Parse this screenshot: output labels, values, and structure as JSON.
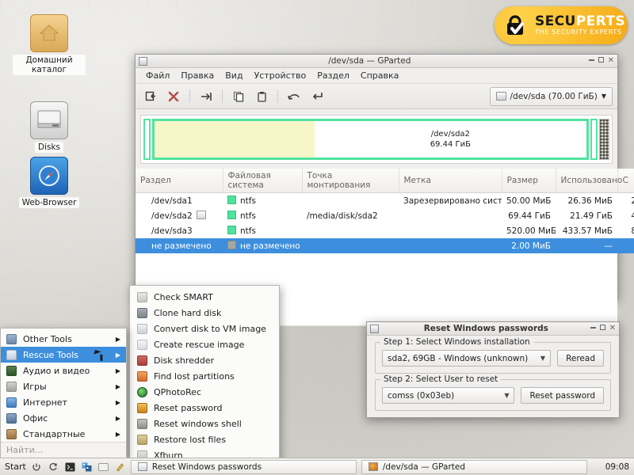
{
  "desktop": {
    "icons": [
      {
        "name": "home-folder",
        "label": "Домашний каталог",
        "icon": "home-icon"
      },
      {
        "name": "disks",
        "label": "Disks",
        "icon": "drive-icon"
      },
      {
        "name": "web-browser",
        "label": "Web-Browser",
        "icon": "compass-icon"
      }
    ]
  },
  "logo": {
    "icon": "lock-check-icon",
    "brand_primary": "SECU",
    "brand_secondary": "PERTS",
    "tagline": "THE SECURITY EXPERTS",
    "bg_color": "#f5ab16"
  },
  "gparted": {
    "title": "/dev/sda — GParted",
    "window_icon": "gparted-icon",
    "buttons": {
      "minimize": "minimize-icon",
      "maximize": "maximize-icon",
      "close": "close-icon"
    },
    "menu": [
      "Файл",
      "Правка",
      "Вид",
      "Устройство",
      "Раздел",
      "Справка"
    ],
    "toolbar": [
      {
        "name": "new-partition-button",
        "glyph": "⊐"
      },
      {
        "name": "delete-partition-button",
        "glyph": "✖"
      },
      {
        "name": "resize-move-button",
        "glyph": "⇥"
      },
      {
        "name": "copy-button",
        "glyph": "❐"
      },
      {
        "name": "paste-button",
        "glyph": "📋"
      },
      {
        "name": "undo-button",
        "glyph": "↶"
      },
      {
        "name": "apply-button",
        "glyph": "↵"
      }
    ],
    "device_selector": {
      "label": "/dev/sda  (70.00 ГиБ)",
      "arrow": "▼",
      "icon": "hdd-icon"
    },
    "graphic": {
      "main_partition": "/dev/sda2",
      "main_size": "69.44 ГиБ",
      "used_fraction_pct": 37
    },
    "table": {
      "columns": [
        "Раздел",
        "Файловая система",
        "Точка монтирования",
        "Метка",
        "Размер",
        "Использовано",
        "С"
      ],
      "rows": [
        {
          "partition": "/dev/sda1",
          "fs": "ntfs",
          "fs_color": "#4ee39e",
          "mount": "",
          "label": "Зарезервировано системой",
          "size": "50.00 МиБ",
          "used": "26.36 МиБ",
          "free": "2",
          "mounted_icon": false,
          "selected": false
        },
        {
          "partition": "/dev/sda2",
          "fs": "ntfs",
          "fs_color": "#4ee39e",
          "mount": "/media/disk/sda2",
          "label": "",
          "size": "69.44 ГиБ",
          "used": "21.49 ГиБ",
          "free": "4",
          "mounted_icon": true,
          "selected": false
        },
        {
          "partition": "/dev/sda3",
          "fs": "ntfs",
          "fs_color": "#4ee39e",
          "mount": "",
          "label": "",
          "size": "520.00 МиБ",
          "used": "433.57 МиБ",
          "free": "8",
          "mounted_icon": false,
          "selected": false
        },
        {
          "partition": "не размечено",
          "fs": "не размечено",
          "fs_color": "#a8a6a2",
          "mount": "",
          "label": "",
          "size": "2.00 МиБ",
          "used": "—",
          "free": "",
          "mounted_icon": false,
          "selected": true
        }
      ]
    }
  },
  "reset_dialog": {
    "title": "Reset Windows passwords",
    "window_icon": "app-icon",
    "buttons": {
      "minimize": "minimize-icon",
      "maximize": "maximize-icon",
      "close": "close-icon"
    },
    "step1": {
      "legend": "Step 1: Select Windows installation",
      "combo_value": "sda2, 69GB - Windows (unknown)",
      "combo_arrow": "▼",
      "button": "Reread"
    },
    "step2": {
      "legend": "Step 2: Select User to reset",
      "combo_value": "comss (0x03eb)",
      "combo_arrow": "▼",
      "button": "Reset password"
    }
  },
  "submenu": {
    "items": [
      {
        "label": "Check SMART",
        "icon": "smart-icon",
        "color": "#cfcfcb"
      },
      {
        "label": "Clone hard disk",
        "icon": "clone-icon",
        "color": "#8e9095"
      },
      {
        "label": "Convert disk to VM image",
        "icon": "convert-icon",
        "color": "#d5d8dc"
      },
      {
        "label": "Create rescue image",
        "icon": "rescue-image-icon",
        "color": "#dfe2e6"
      },
      {
        "label": "Disk shredder",
        "icon": "shredder-icon",
        "color": "#c0504d"
      },
      {
        "label": "Find lost partitions",
        "icon": "find-partitions-icon",
        "color": "#e08a3c"
      },
      {
        "label": "QPhotoRec",
        "icon": "qphotorec-icon",
        "color": "#2f8f3f"
      },
      {
        "label": "Reset password",
        "icon": "reset-password-icon",
        "color": "#e2a43a"
      },
      {
        "label": "Reset windows shell",
        "icon": "reset-shell-icon",
        "color": "#9b9b97"
      },
      {
        "label": "Restore lost files",
        "icon": "restore-files-icon",
        "color": "#c3b47a"
      },
      {
        "label": "Xfburn",
        "icon": "xfburn-icon",
        "color": "#c8c8c4"
      }
    ]
  },
  "startmenu": {
    "items": [
      {
        "label": "Other Tools",
        "icon": "other-tools-icon",
        "color": "#8aa6c8",
        "chevron": "▶",
        "active": false
      },
      {
        "label": "Rescue Tools",
        "icon": "rescue-tools-icon",
        "color": "#cdd6e2",
        "chevron": "▶",
        "active": true
      },
      {
        "label": "Аудио и видео",
        "icon": "audio-video-icon",
        "color": "#3f6b35",
        "chevron": "▶",
        "active": false
      },
      {
        "label": "Игры",
        "icon": "games-icon",
        "color": "#b8b8b4",
        "chevron": "▶",
        "active": false
      },
      {
        "label": "Интернет",
        "icon": "internet-icon",
        "color": "#5b9bd5",
        "chevron": "▶",
        "active": false
      },
      {
        "label": "Офис",
        "icon": "office-icon",
        "color": "#6e8fb5",
        "chevron": "▶",
        "active": false
      },
      {
        "label": "Стандартные",
        "icon": "accessories-icon",
        "color": "#b08a57",
        "chevron": "▶",
        "active": false
      }
    ],
    "search_placeholder": "Найти..."
  },
  "taskbar": {
    "start_label": "Start",
    "sysicons": [
      {
        "name": "power-icon",
        "glyph": "⏻"
      },
      {
        "name": "restart-icon",
        "glyph": "⟳"
      },
      {
        "name": "terminal-icon",
        "glyph": "▰"
      },
      {
        "name": "network-icon",
        "glyph": "▚"
      },
      {
        "name": "files-icon",
        "glyph": "▢"
      },
      {
        "name": "editor-icon",
        "glyph": "✎"
      }
    ],
    "windows": [
      {
        "label": "Reset Windows passwords",
        "icon": "app-icon",
        "active": false
      },
      {
        "label": "/dev/sda — GParted",
        "icon": "gparted-icon",
        "active": false
      }
    ],
    "clock": "09:08"
  }
}
